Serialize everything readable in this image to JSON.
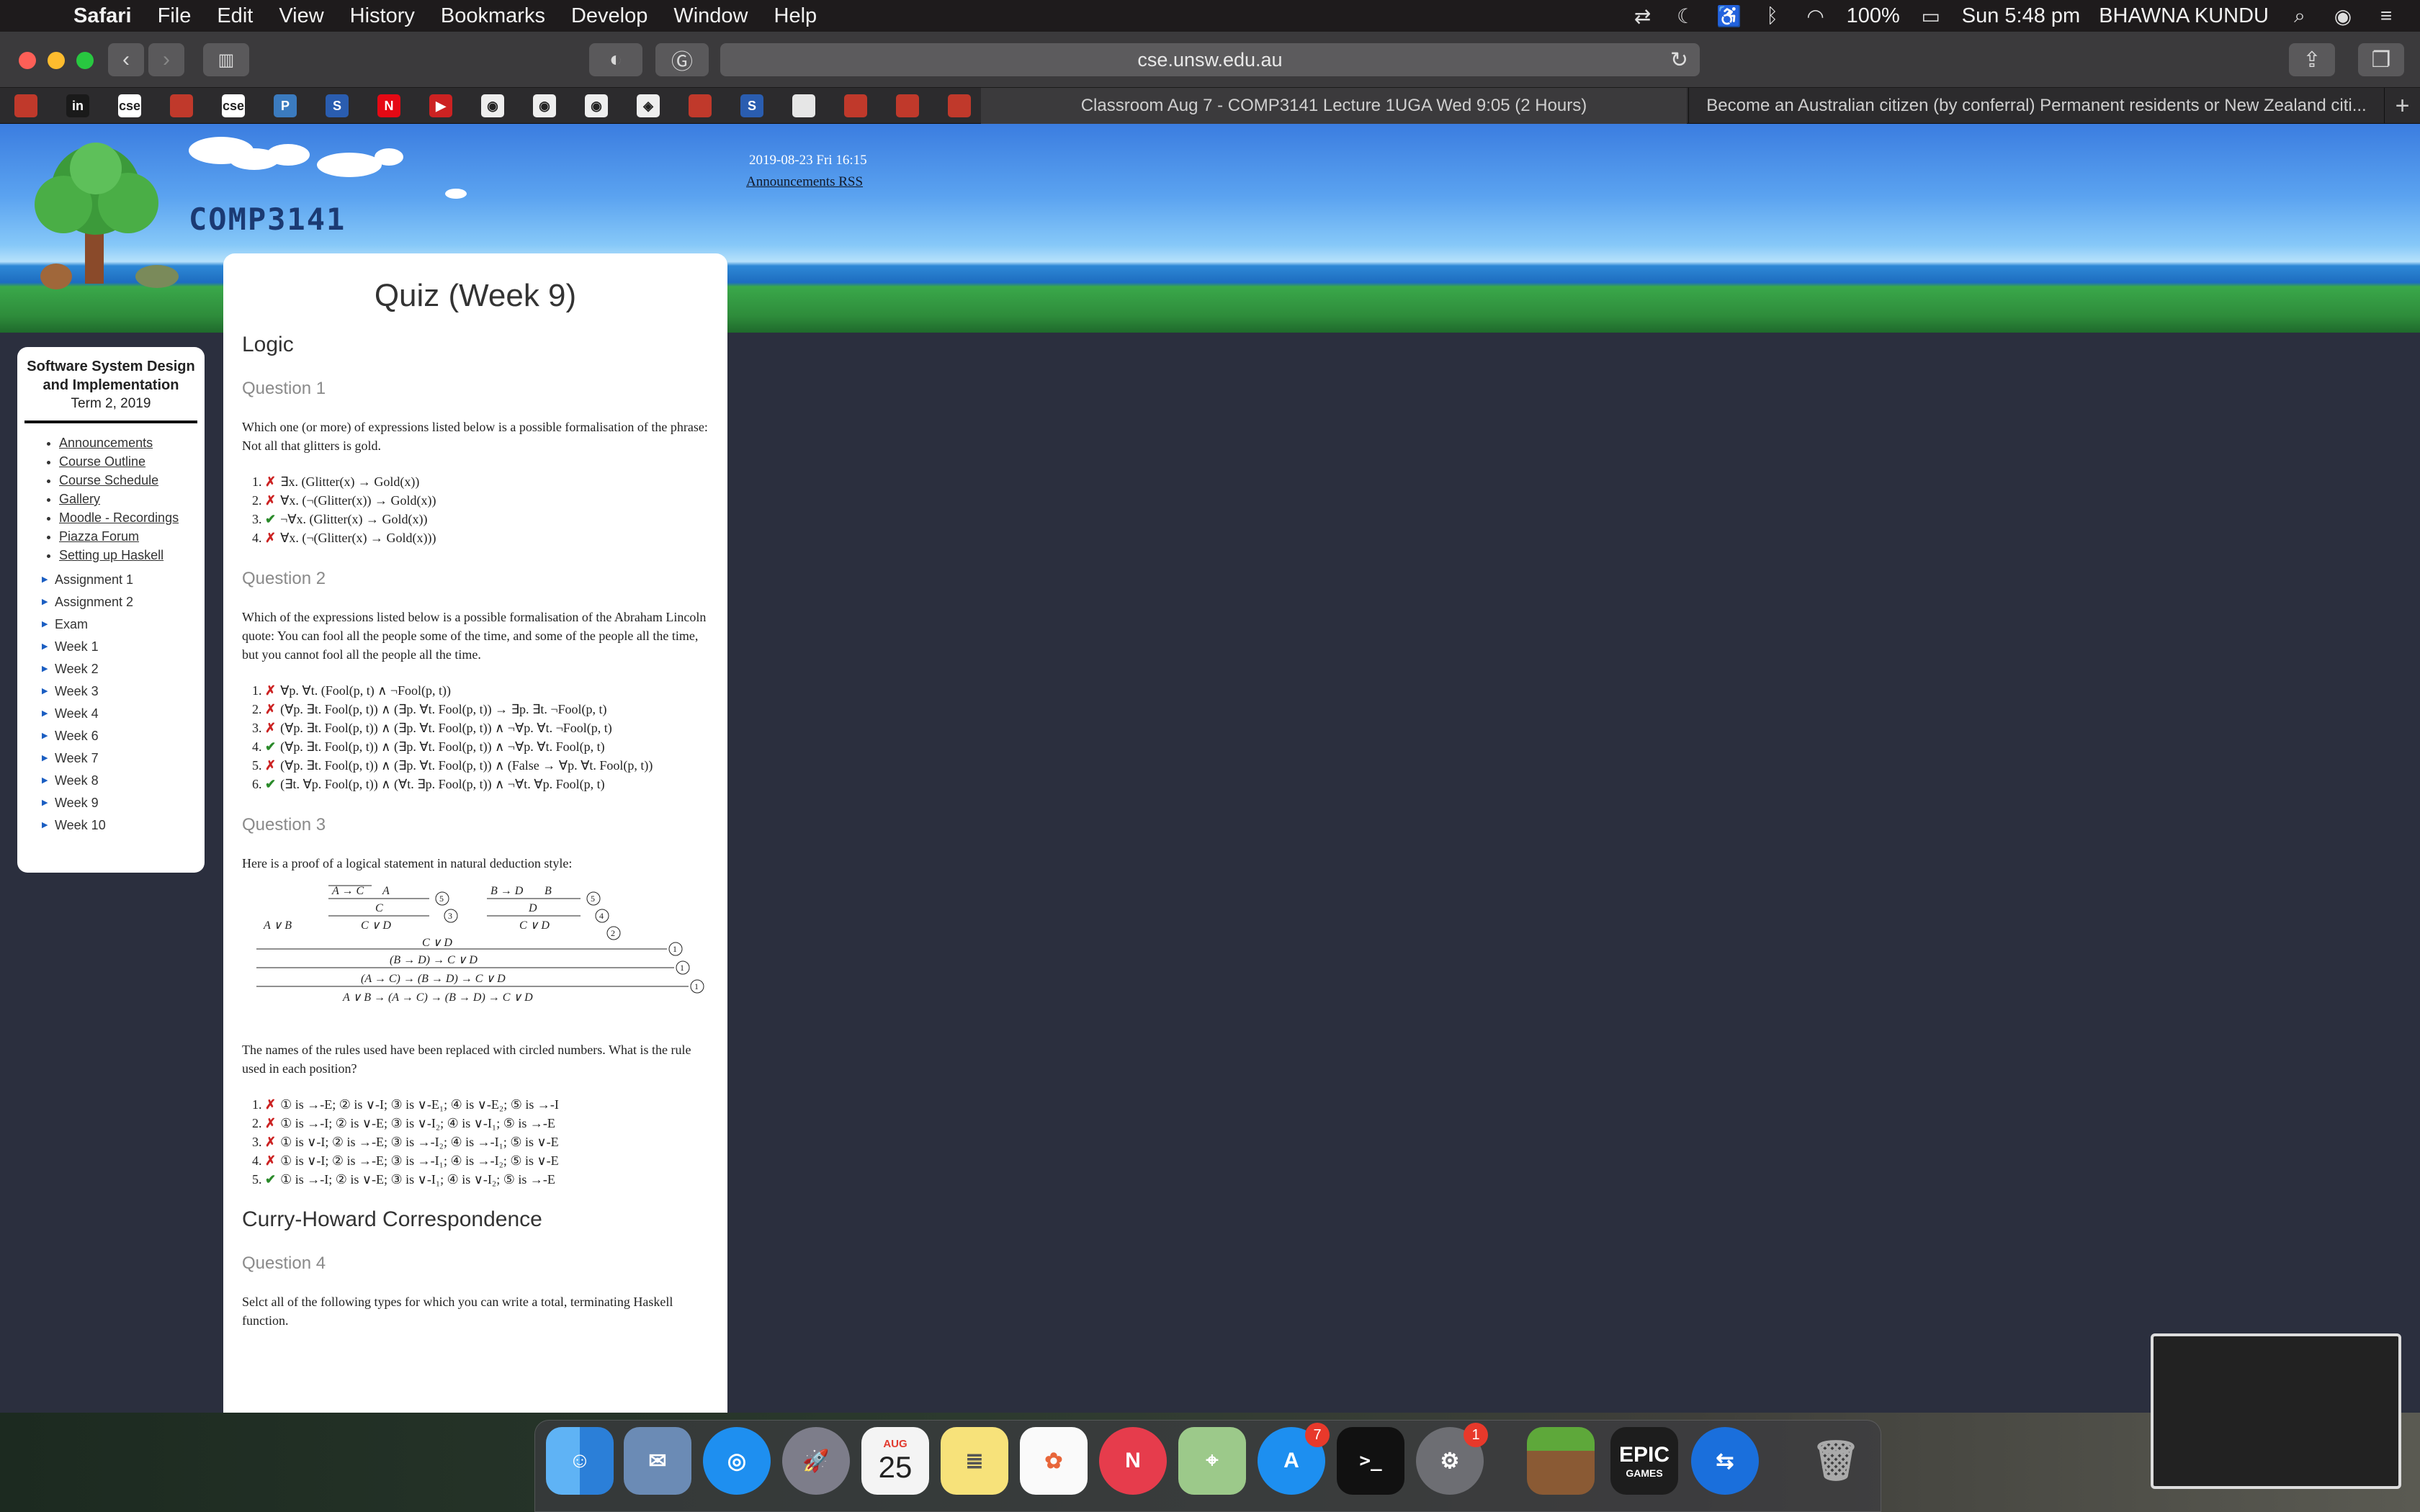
{
  "menubar": {
    "app": "Safari",
    "items": [
      "File",
      "Edit",
      "View",
      "History",
      "Bookmarks",
      "Develop",
      "Window",
      "Help"
    ],
    "battery": "100%",
    "clock": "Sun 5:48 pm",
    "user": "BHAWNA KUNDU"
  },
  "toolbar": {
    "url": "cse.unsw.edu.au"
  },
  "tabs": [
    "Classroom Aug 7 - COMP3141 Lecture 1UGA Wed 9:05 (2 Hours)",
    "Become an Australian citizen (by conferral) Permanent residents or New Zealand citi..."
  ],
  "pinned": [
    {
      "icon": "unsw-crest-icon",
      "label": "",
      "color": "#c0392b"
    },
    {
      "icon": "ing-icon",
      "label": "in",
      "color": "#1a1a1a"
    },
    {
      "icon": "cse-icon",
      "label": "cse",
      "color": "#ffffff"
    },
    {
      "icon": "unsw-crest-icon",
      "label": "",
      "color": "#c0392b"
    },
    {
      "icon": "cse-icon",
      "label": "cse",
      "color": "#ffffff"
    },
    {
      "icon": "p-icon",
      "label": "P",
      "color": "#3b7bbf"
    },
    {
      "icon": "s-icon",
      "label": "S",
      "color": "#2a5db0"
    },
    {
      "icon": "netflix-icon",
      "label": "N",
      "color": "#e50914"
    },
    {
      "icon": "youtube-icon",
      "label": "▶",
      "color": "#cc2222"
    },
    {
      "icon": "github-icon",
      "label": "◉",
      "color": "#eeeeee"
    },
    {
      "icon": "github-icon",
      "label": "◉",
      "color": "#eeeeee"
    },
    {
      "icon": "github-icon",
      "label": "◉",
      "color": "#eeeeee"
    },
    {
      "icon": "octagon-icon",
      "label": "◈",
      "color": "#eeeeee"
    },
    {
      "icon": "unsw-crest-icon",
      "label": "",
      "color": "#c0392b"
    },
    {
      "icon": "s-icon",
      "label": "S",
      "color": "#2a5db0"
    },
    {
      "icon": "blank-icon",
      "label": "",
      "color": "#e6e6e6"
    },
    {
      "icon": "unsw-crest-icon",
      "label": "",
      "color": "#c0392b"
    },
    {
      "icon": "unsw-crest-icon",
      "label": "",
      "color": "#c0392b"
    },
    {
      "icon": "unsw-crest-icon",
      "label": "",
      "color": "#c0392b"
    }
  ],
  "banner": {
    "logo": "COMP3141",
    "date": "2019-08-23 Fri 16:15",
    "rss": "Announcements RSS"
  },
  "sidebar": {
    "title": "Software System Design and Implementation",
    "term": "Term 2, 2019",
    "links": [
      "Announcements",
      "Course Outline",
      "Course Schedule",
      "Gallery",
      "Moodle - Recordings",
      "Piazza Forum",
      "Setting up Haskell"
    ],
    "sections": [
      "Assignment 1",
      "Assignment 2",
      "Exam",
      "Week 1",
      "Week 2",
      "Week 3",
      "Week 4",
      "Week 6",
      "Week 7",
      "Week 8",
      "Week 9",
      "Week 10"
    ]
  },
  "quiz": {
    "title": "Quiz (Week 9)",
    "sections": [
      "Logic",
      "Curry-Howard Correspondence"
    ],
    "q1": {
      "heading": "Question 1",
      "text": "Which one (or more) of expressions listed below is a possible formalisation of the phrase: Not all that glitters is gold.",
      "answers": [
        {
          "mark": "✗",
          "ok": false,
          "text": "∃x.  (Glitter(x) → Gold(x))"
        },
        {
          "mark": "✗",
          "ok": false,
          "text": "∀x.  (¬(Glitter(x)) → Gold(x))"
        },
        {
          "mark": "✔",
          "ok": true,
          "text": "¬∀x. (Glitter(x) → Gold(x))"
        },
        {
          "mark": "✗",
          "ok": false,
          "text": "∀x.  (¬(Glitter(x) → Gold(x)))"
        }
      ]
    },
    "q2": {
      "heading": "Question 2",
      "text": "Which of the expressions listed below is a possible formalisation of the Abraham Lincoln quote: You can fool all the people some of the time, and some of the people all the time, but you cannot fool all the people all the time.",
      "answers": [
        {
          "mark": "✗",
          "ok": false,
          "text": "∀p. ∀t. (Fool(p, t) ∧ ¬Fool(p, t))"
        },
        {
          "mark": "✗",
          "ok": false,
          "text": "(∀p. ∃t. Fool(p, t)) ∧ (∃p. ∀t. Fool(p, t)) → ∃p. ∃t. ¬Fool(p, t)"
        },
        {
          "mark": "✗",
          "ok": false,
          "text": "(∀p. ∃t. Fool(p, t)) ∧ (∃p. ∀t. Fool(p, t)) ∧ ¬∀p. ∀t. ¬Fool(p, t)"
        },
        {
          "mark": "✔",
          "ok": true,
          "text": "(∀p. ∃t. Fool(p, t)) ∧ (∃p. ∀t. Fool(p, t)) ∧ ¬∀p. ∀t. Fool(p, t)"
        },
        {
          "mark": "✗",
          "ok": false,
          "text": "(∀p. ∃t. Fool(p, t)) ∧ (∃p. ∀t. Fool(p, t)) ∧ (False → ∀p. ∀t. Fool(p, t))"
        },
        {
          "mark": "✔",
          "ok": true,
          "text": "(∃t. ∀p. Fool(p, t)) ∧ (∀t. ∃p. Fool(p, t)) ∧ ¬∀t. ∀p. Fool(p, t)"
        }
      ]
    },
    "q3": {
      "heading": "Question 3",
      "text": "Here is a proof of a logical statement in natural deduction style:",
      "proof": {
        "l1a": "A → C",
        "l1b": "A",
        "l1c": "B → D",
        "l1d": "B",
        "l2a": "C",
        "l2b": "D",
        "avb": "A ∨ B",
        "l3a": "C ∨ D",
        "l3b": "C ∨ D",
        "l4": "C ∨ D",
        "l5": "(B → D) → C ∨ D",
        "l6": "(A → C) → (B → D) → C ∨ D",
        "l7": "A ∨ B → (A → C) → (B → D) → C ∨ D",
        "c1": "1",
        "c2": "2",
        "c3": "3",
        "c4": "4",
        "c5": "5"
      },
      "text2": "The names of the rules used have been replaced with circled numbers. What is the rule used in each position?",
      "answers": [
        {
          "mark": "✗",
          "ok": false,
          "text": "① is →-E; ② is ∨-I; ③ is ∨-E₁; ④ is ∨-E₂; ⑤ is →-I"
        },
        {
          "mark": "✗",
          "ok": false,
          "text": "① is →-I; ② is ∨-E; ③ is ∨-I₂; ④ is ∨-I₁; ⑤ is →-E"
        },
        {
          "mark": "✗",
          "ok": false,
          "text": "① is ∨-I; ② is →-E; ③ is →-I₂; ④ is →-I₁; ⑤ is ∨-E"
        },
        {
          "mark": "✗",
          "ok": false,
          "text": "① is ∨-I; ② is →-E; ③ is →-I₁; ④ is →-I₂; ⑤ is ∨-E"
        },
        {
          "mark": "✔",
          "ok": true,
          "text": "① is →-I; ② is ∨-E; ③ is ∨-I₁; ④ is ∨-I₂; ⑤ is →-E"
        }
      ]
    },
    "q4": {
      "heading": "Question 4",
      "text": "Selct all of the following types for which you can write a total, terminating Haskell function."
    }
  },
  "dock": {
    "calendar_month": "AUG",
    "calendar_day": "25",
    "appstore_badge": "7",
    "prefs_badge": "1",
    "epic_label": "EPIC",
    "epic_sub": "GAMES"
  }
}
